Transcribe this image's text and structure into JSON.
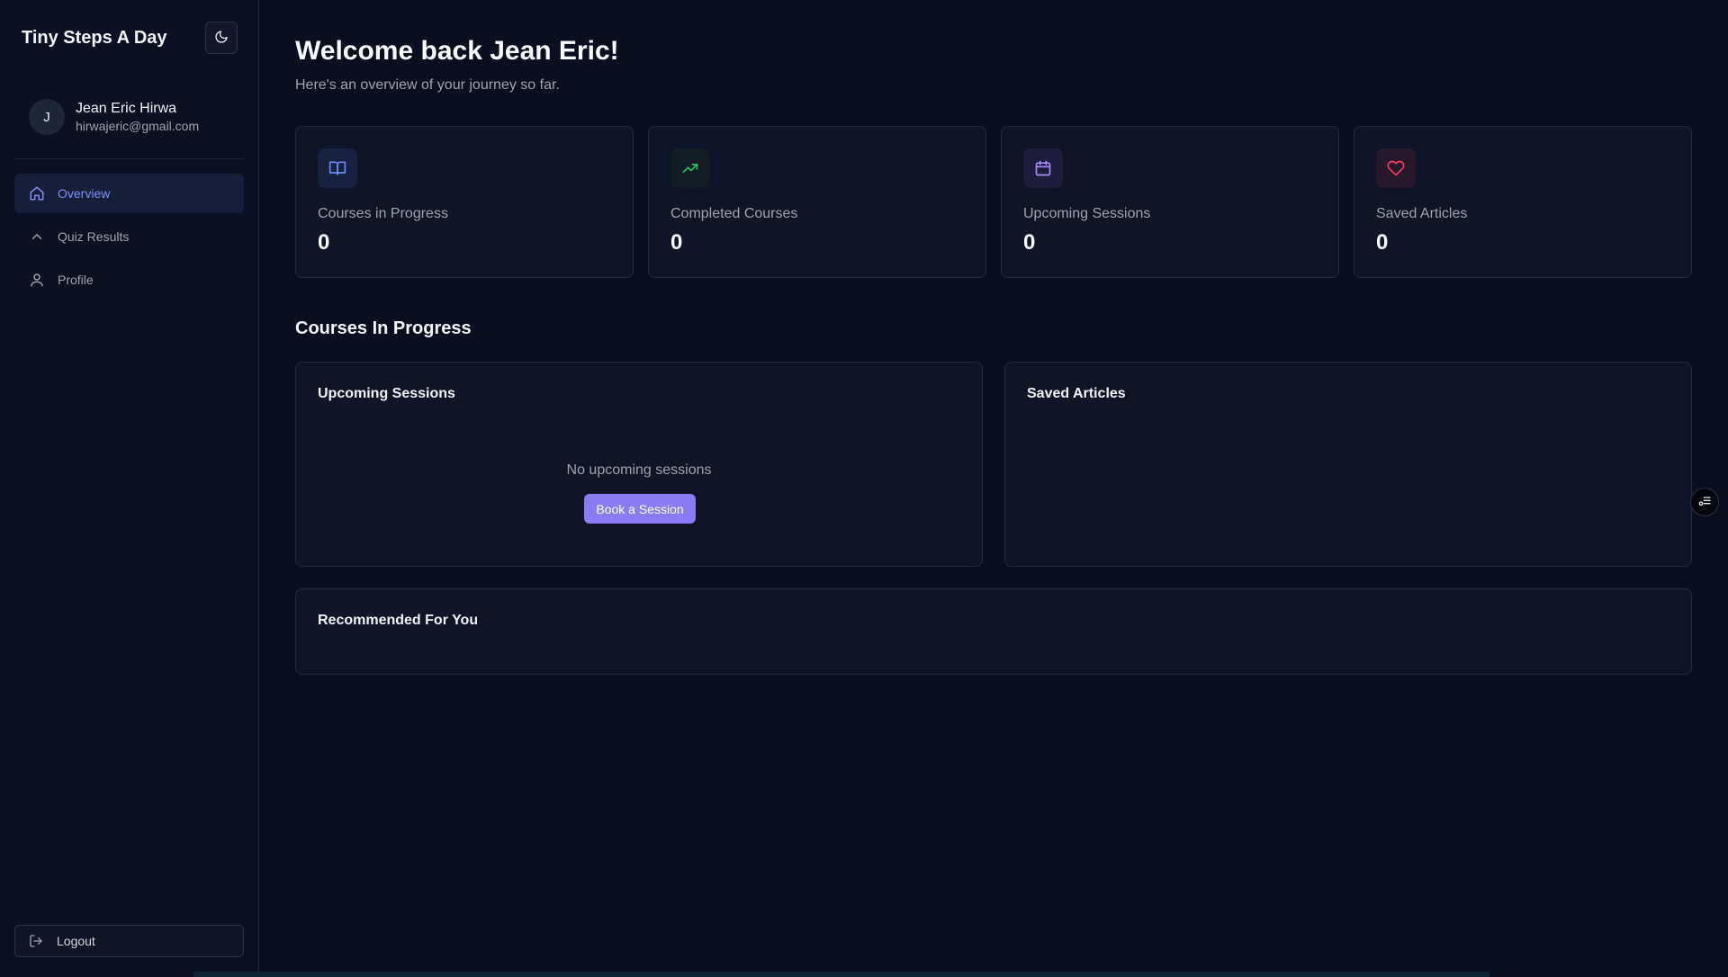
{
  "app": {
    "title": "Tiny Steps A Day",
    "theme_icon": "moon-icon"
  },
  "user": {
    "initial": "J",
    "name": "Jean Eric Hirwa",
    "email": "hirwajeric@gmail.com"
  },
  "nav": {
    "items": [
      {
        "label": "Overview",
        "icon": "home-icon",
        "active": true
      },
      {
        "label": "Quiz Results",
        "icon": "chevron-up-icon",
        "active": false
      },
      {
        "label": "Profile",
        "icon": "user-icon",
        "active": false
      }
    ],
    "logout_label": "Logout",
    "logout_icon": "logout-icon"
  },
  "header": {
    "title": "Welcome back Jean Eric!",
    "subtitle": "Here's an overview of your journey so far."
  },
  "stats": [
    {
      "label": "Courses in Progress",
      "value": "0",
      "icon": "book-open-icon",
      "color": "#6b8cf5"
    },
    {
      "label": "Completed Courses",
      "value": "0",
      "icon": "trending-up-icon",
      "color": "#22c55e"
    },
    {
      "label": "Upcoming Sessions",
      "value": "0",
      "icon": "calendar-icon",
      "color": "#a78bfa"
    },
    {
      "label": "Saved Articles",
      "value": "0",
      "icon": "heart-icon",
      "color": "#f43f5e"
    }
  ],
  "sections": {
    "courses_title": "Courses In Progress",
    "sessions": {
      "title": "Upcoming Sessions",
      "empty_text": "No upcoming sessions",
      "button_label": "Book a Session"
    },
    "articles": {
      "title": "Saved Articles"
    },
    "recommended": {
      "title": "Recommended For You"
    }
  },
  "floating": {
    "icon": "filter-list-icon"
  }
}
